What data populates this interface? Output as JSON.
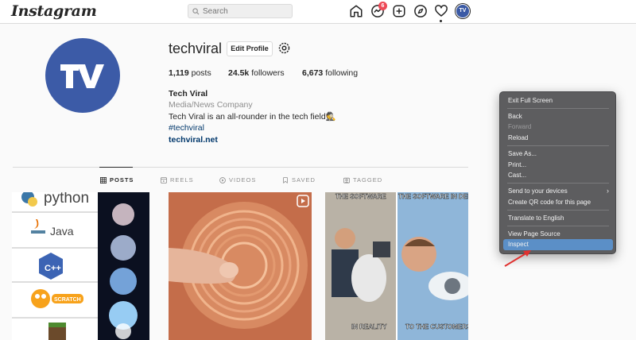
{
  "nav": {
    "logo": "Instagram",
    "search_placeholder": "Search",
    "notification_count": "6",
    "avatar_text": "TV"
  },
  "profile": {
    "avatar_text": "TV",
    "username": "techviral",
    "edit_label": "Edit Profile",
    "posts_count": "1,119",
    "posts_label": "posts",
    "followers_count": "24.5k",
    "followers_label": "followers",
    "following_count": "6,673",
    "following_label": "following",
    "name": "Tech Viral",
    "category": "Media/News Company",
    "bio": "Tech Viral is an all-rounder in the tech field🕵",
    "hashtag": "#techviral",
    "link": "techviral.net"
  },
  "tabs": [
    {
      "label": "POSTS",
      "icon": "grid-icon",
      "active": true
    },
    {
      "label": "REELS",
      "icon": "reels-icon",
      "active": false
    },
    {
      "label": "VIDEOS",
      "icon": "play-icon",
      "active": false
    },
    {
      "label": "SAVED",
      "icon": "bookmark-icon",
      "active": false
    },
    {
      "label": "TAGGED",
      "icon": "tag-icon",
      "active": false
    }
  ],
  "posts": [
    {
      "id": "post-1",
      "labels": [
        "python",
        "Java",
        "C++",
        "SCRATCH"
      ]
    },
    {
      "id": "post-2"
    },
    {
      "id": "post-3",
      "labels": [
        "THE SOFTWARE",
        "THE SOFTWARE IN DEMO",
        "IN REALITY",
        "TO THE CUSTOMERS"
      ]
    }
  ],
  "context_menu": {
    "items": [
      {
        "label": "Exit Full Screen",
        "disabled": false
      },
      {
        "label": "Back",
        "disabled": false
      },
      {
        "label": "Forward",
        "disabled": true
      },
      {
        "label": "Reload",
        "disabled": false
      },
      {
        "label": "Save As...",
        "disabled": false
      },
      {
        "label": "Print...",
        "disabled": false
      },
      {
        "label": "Cast...",
        "disabled": false
      },
      {
        "label": "Send to your devices",
        "disabled": false
      },
      {
        "label": "Create QR code for this page",
        "disabled": false
      },
      {
        "label": "Translate to English",
        "disabled": false
      },
      {
        "label": "View Page Source",
        "disabled": false
      },
      {
        "label": "Inspect",
        "disabled": false,
        "highlighted": true
      }
    ],
    "highlight_color": "#5b8fc7"
  },
  "colors": {
    "brand_blue": "#3c5ba7",
    "link": "#00376b",
    "badge": "#ed4956",
    "arrow": "#e0312f"
  }
}
